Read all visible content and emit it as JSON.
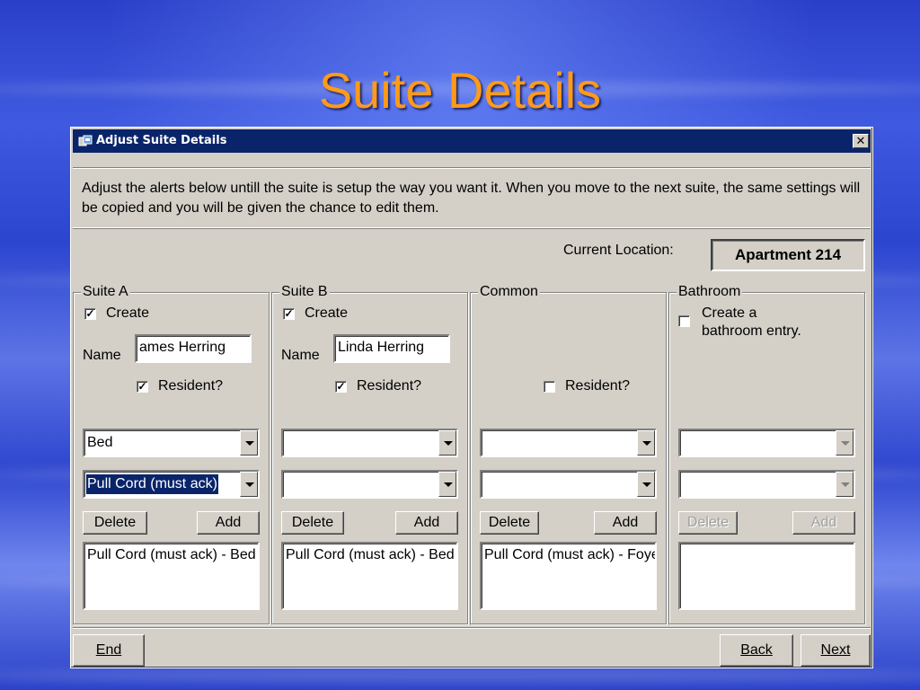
{
  "slide": {
    "title": "Suite Details"
  },
  "window": {
    "title": "Adjust Suite Details",
    "close_glyph": "✕"
  },
  "instructions": "Adjust the alerts below untill the suite is setup the way you want it.  When you move to the next suite, the same settings will be copied and you will be given the chance to edit them.",
  "location": {
    "label": "Current Location:",
    "value": "Apartment 214"
  },
  "groups": [
    {
      "title": "Suite A",
      "create_label": "Create",
      "create_checked": true,
      "name_label": "Name",
      "name_value": "ames Herring",
      "resident_label": "Resident?",
      "resident_checked": true,
      "combo1": "Bed",
      "combo2": "Pull Cord (must ack)",
      "delete_label": "Delete",
      "add_label": "Add",
      "list_items": [
        "Pull Cord (must ack) - Bed"
      ]
    },
    {
      "title": "Suite B",
      "create_label": "Create",
      "create_checked": true,
      "name_label": "Name",
      "name_value": "Linda Herring",
      "resident_label": "Resident?",
      "resident_checked": true,
      "combo1": "",
      "combo2": "",
      "delete_label": "Delete",
      "add_label": "Add",
      "list_items": [
        "Pull Cord (must ack) - Bed"
      ]
    },
    {
      "title": "Common",
      "resident_label": "Resident?",
      "resident_checked": false,
      "combo1": "",
      "combo2": "",
      "delete_label": "Delete",
      "add_label": "Add",
      "list_items": [
        "Pull Cord (must ack) - Foyer"
      ]
    },
    {
      "title": "Bathroom",
      "create_label_line1": "Create a",
      "create_label_line2": "bathroom entry.",
      "create_checked": false,
      "combo1": "",
      "combo2": "",
      "delete_label": "Delete",
      "add_label": "Add",
      "list_items": []
    }
  ],
  "footer": {
    "end_label": "End",
    "back_label": "Back",
    "next_label": "Next"
  },
  "colors": {
    "title_orange": "#ff9a1a",
    "titlebar_navy": "#0a246a",
    "dialog_gray": "#d4d0c8"
  },
  "icons": {
    "app": "window-app-icon",
    "close": "close-icon",
    "dropdown": "chevron-down-icon",
    "check": "checkmark-icon"
  }
}
